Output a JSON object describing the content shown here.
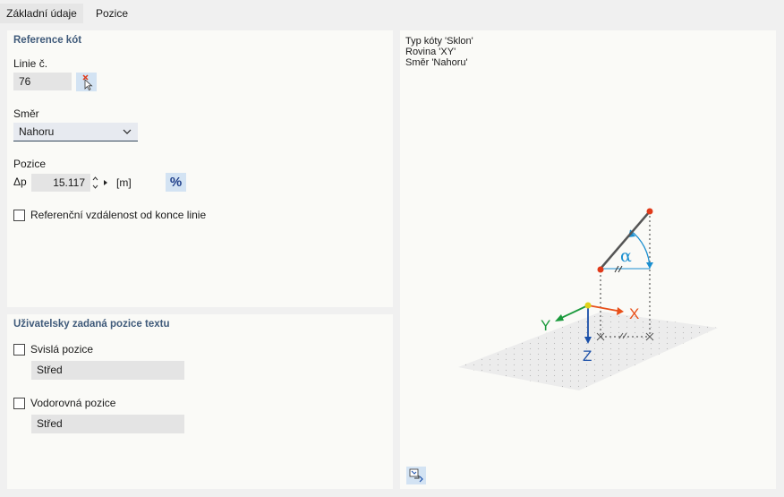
{
  "tabs": [
    {
      "label": "Základní údaje"
    },
    {
      "label": "Pozice"
    }
  ],
  "reference": {
    "title": "Reference kót",
    "line_label": "Linie č.",
    "line_value": "76",
    "direction_label": "Směr",
    "direction_value": "Nahoru",
    "position_label": "Pozice",
    "delta_label": "Δp",
    "delta_value": "15.117",
    "unit": "[m]",
    "percent_label": "%",
    "ref_distance_checkbox": "Referenční vzdálenost od konce linie"
  },
  "user_position": {
    "title": "Uživatelsky zadaná pozice textu",
    "vertical_label": "Svislá pozice",
    "vertical_value": "Střed",
    "horizontal_label": "Vodorovná pozice",
    "horizontal_value": "Střed"
  },
  "preview": {
    "info": [
      "Typ kóty 'Sklon'",
      "Rovina 'XY'",
      "Směr 'Nahoru'"
    ],
    "axis_x": "X",
    "axis_y": "Y",
    "axis_z": "Z",
    "angle_symbol": "α",
    "colors": {
      "x": "#e8501a",
      "y": "#1a9a3c",
      "z": "#1a4fa8",
      "dim": "#1a8fd0",
      "point": "#e03a1a"
    }
  }
}
